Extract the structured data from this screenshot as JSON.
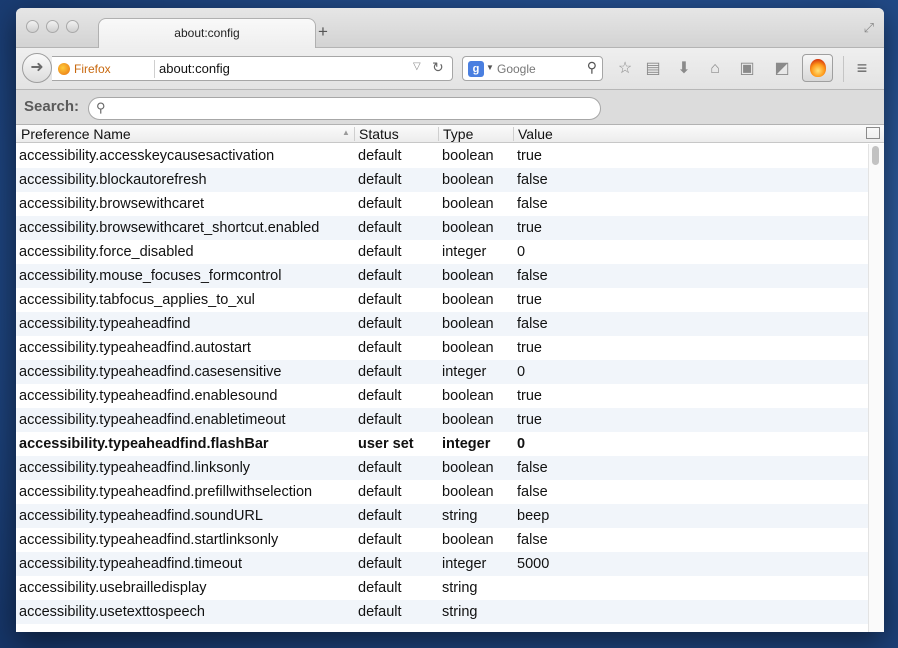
{
  "tab": {
    "title": "about:config"
  },
  "urlbar": {
    "identity": "Firefox",
    "url": "about:config"
  },
  "search_engine": {
    "placeholder": "Google"
  },
  "config_search": {
    "label": "Search:",
    "value": ""
  },
  "columns": {
    "name": "Preference Name",
    "status": "Status",
    "type": "Type",
    "value": "Value"
  },
  "rows": [
    {
      "name": "accessibility.accesskeycausesactivation",
      "status": "default",
      "type": "boolean",
      "value": "true"
    },
    {
      "name": "accessibility.blockautorefresh",
      "status": "default",
      "type": "boolean",
      "value": "false"
    },
    {
      "name": "accessibility.browsewithcaret",
      "status": "default",
      "type": "boolean",
      "value": "false"
    },
    {
      "name": "accessibility.browsewithcaret_shortcut.enabled",
      "status": "default",
      "type": "boolean",
      "value": "true"
    },
    {
      "name": "accessibility.force_disabled",
      "status": "default",
      "type": "integer",
      "value": "0"
    },
    {
      "name": "accessibility.mouse_focuses_formcontrol",
      "status": "default",
      "type": "boolean",
      "value": "false"
    },
    {
      "name": "accessibility.tabfocus_applies_to_xul",
      "status": "default",
      "type": "boolean",
      "value": "true"
    },
    {
      "name": "accessibility.typeaheadfind",
      "status": "default",
      "type": "boolean",
      "value": "false"
    },
    {
      "name": "accessibility.typeaheadfind.autostart",
      "status": "default",
      "type": "boolean",
      "value": "true"
    },
    {
      "name": "accessibility.typeaheadfind.casesensitive",
      "status": "default",
      "type": "integer",
      "value": "0"
    },
    {
      "name": "accessibility.typeaheadfind.enablesound",
      "status": "default",
      "type": "boolean",
      "value": "true"
    },
    {
      "name": "accessibility.typeaheadfind.enabletimeout",
      "status": "default",
      "type": "boolean",
      "value": "true"
    },
    {
      "name": "accessibility.typeaheadfind.flashBar",
      "status": "user set",
      "type": "integer",
      "value": "0",
      "modified": true
    },
    {
      "name": "accessibility.typeaheadfind.linksonly",
      "status": "default",
      "type": "boolean",
      "value": "false"
    },
    {
      "name": "accessibility.typeaheadfind.prefillwithselection",
      "status": "default",
      "type": "boolean",
      "value": "false"
    },
    {
      "name": "accessibility.typeaheadfind.soundURL",
      "status": "default",
      "type": "string",
      "value": "beep"
    },
    {
      "name": "accessibility.typeaheadfind.startlinksonly",
      "status": "default",
      "type": "boolean",
      "value": "false"
    },
    {
      "name": "accessibility.typeaheadfind.timeout",
      "status": "default",
      "type": "integer",
      "value": "5000"
    },
    {
      "name": "accessibility.usebrailledisplay",
      "status": "default",
      "type": "string",
      "value": ""
    },
    {
      "name": "accessibility.usetexttospeech",
      "status": "default",
      "type": "string",
      "value": ""
    }
  ],
  "icons": [
    "back-icon",
    "firefox-identity-icon",
    "dropmarker-icon",
    "reload-icon",
    "google-icon",
    "search-icon",
    "bookmark-star-icon",
    "bookmarks-menu-icon",
    "downloads-icon",
    "home-icon",
    "sync-icon",
    "screenshot-icon",
    "addon-flame-icon",
    "menu-icon",
    "fullscreen-icon",
    "column-picker-icon"
  ],
  "colors": {
    "accent": "#e8700f",
    "row_alt": "#f1f5fa"
  }
}
